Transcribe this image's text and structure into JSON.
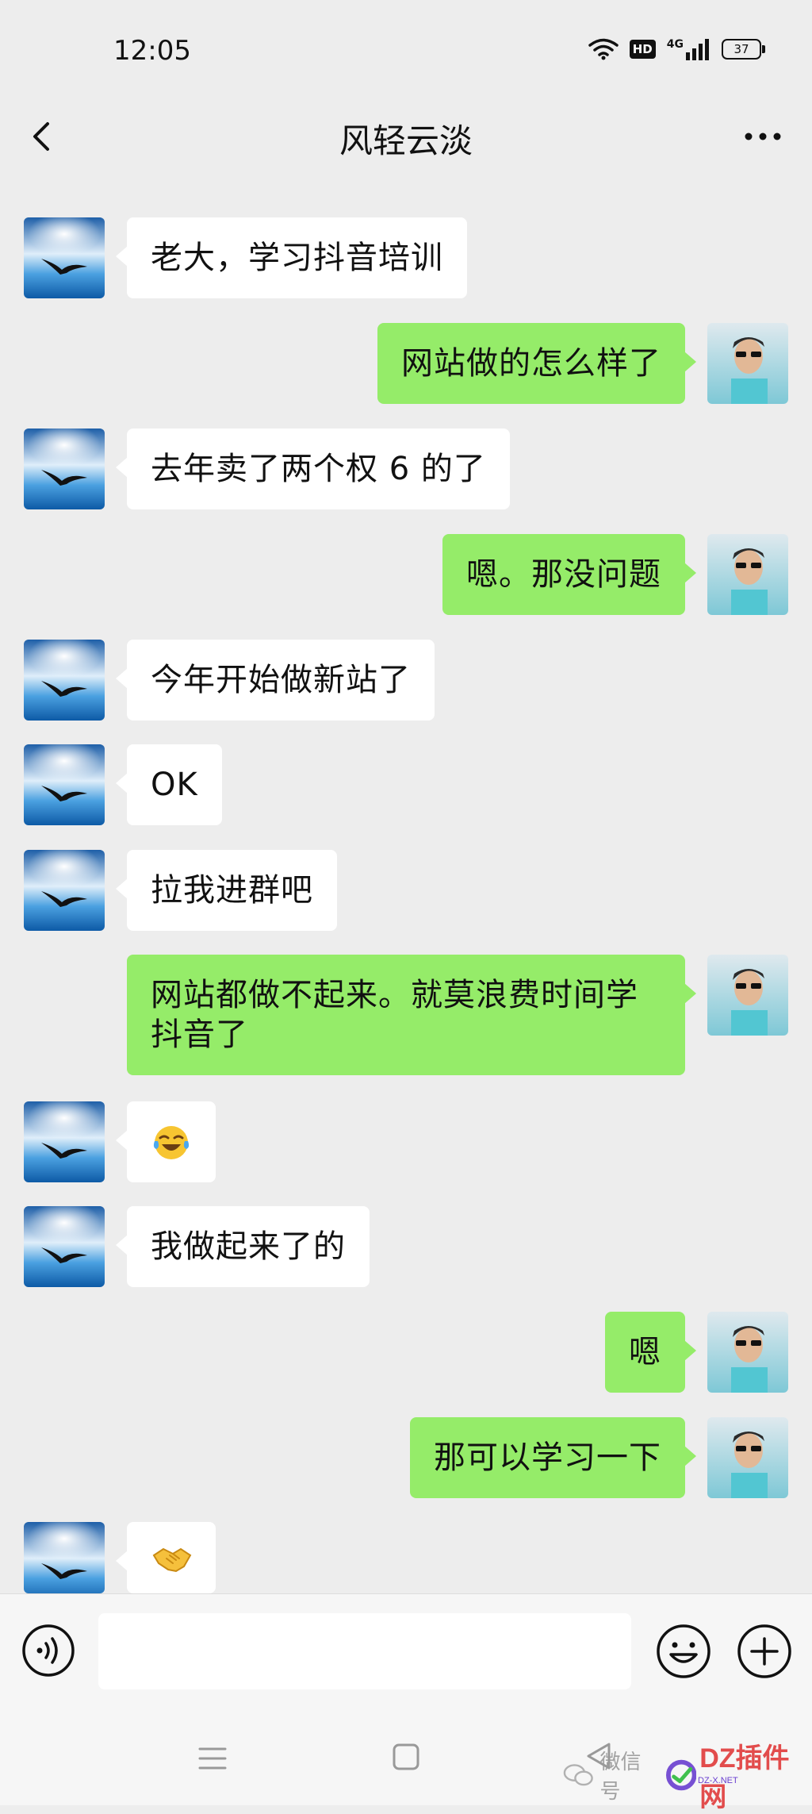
{
  "status_bar": {
    "time": "12:05",
    "hd_label": "HD",
    "network_label": "4G",
    "battery": "37"
  },
  "header": {
    "title": "风轻云淡",
    "back_icon": "chevron-left-icon",
    "more_icon": "more-dots-icon"
  },
  "messages": [
    {
      "side": "left",
      "text": "老大，学习抖音培训"
    },
    {
      "side": "right",
      "text": "网站做的怎么样了"
    },
    {
      "side": "left",
      "text": "去年卖了两个权 6 的了"
    },
    {
      "side": "right",
      "text": "嗯。那没问题"
    },
    {
      "side": "left",
      "text": "今年开始做新站了"
    },
    {
      "side": "left",
      "text": "OK"
    },
    {
      "side": "left",
      "text": "拉我进群吧"
    },
    {
      "side": "right",
      "text": "网站都做不起来。就莫浪费时间学抖音了"
    },
    {
      "side": "left",
      "emoji": "laugh-crying-emoji"
    },
    {
      "side": "left",
      "text": "我做起来了的"
    },
    {
      "side": "right",
      "text": "嗯"
    },
    {
      "side": "right",
      "text": "那可以学习一下"
    },
    {
      "side": "left",
      "emoji": "handshake-emoji"
    }
  ],
  "input_bar": {
    "value": "",
    "voice_icon": "voice-icon",
    "emoji_icon": "emoji-smile-icon",
    "plus_icon": "plus-circle-icon"
  },
  "watermark": {
    "prefix": "微信号",
    "brand": "DZ插件网",
    "sub": "DZ-X.NET"
  },
  "colors": {
    "background": "#ededed",
    "self_bubble": "#95ec69",
    "other_bubble": "#ffffff"
  }
}
